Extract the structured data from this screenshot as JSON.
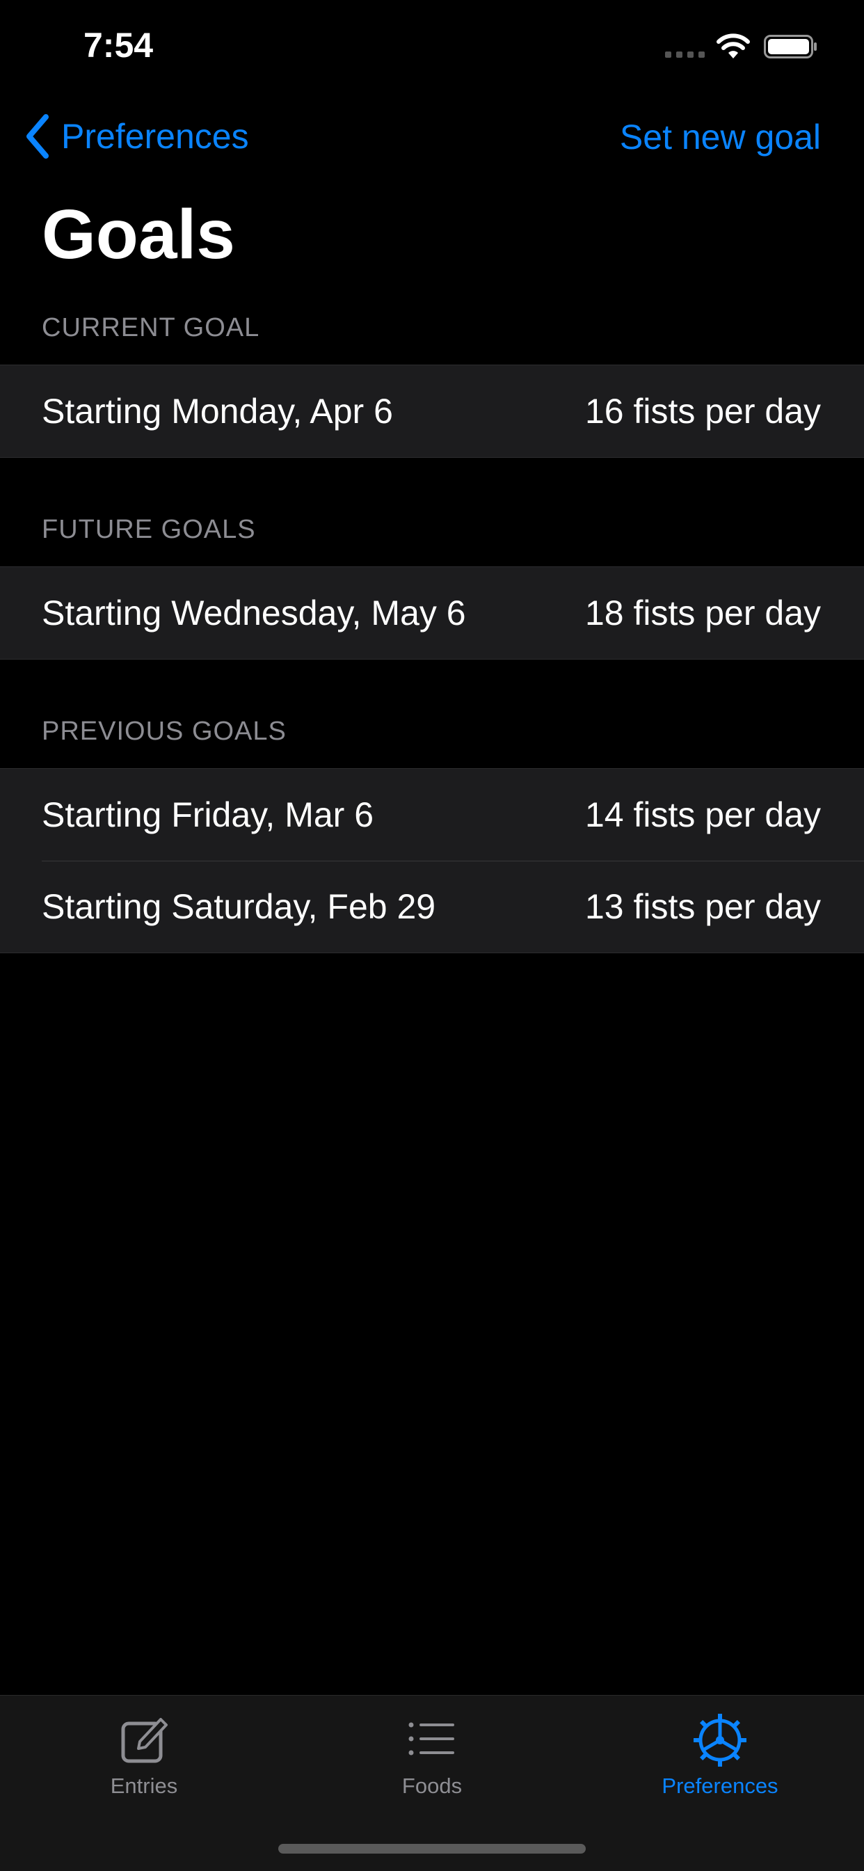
{
  "status_bar": {
    "time": "7:54"
  },
  "nav": {
    "back_label": "Preferences",
    "action_label": "Set new goal"
  },
  "page": {
    "title": "Goals"
  },
  "sections": {
    "current": {
      "header": "CURRENT GOAL",
      "rows": [
        {
          "label": "Starting Monday, Apr 6",
          "value": "16 fists per day"
        }
      ]
    },
    "future": {
      "header": "FUTURE GOALS",
      "rows": [
        {
          "label": "Starting Wednesday, May 6",
          "value": "18 fists per day"
        }
      ]
    },
    "previous": {
      "header": "PREVIOUS GOALS",
      "rows": [
        {
          "label": "Starting Friday, Mar 6",
          "value": "14 fists per day"
        },
        {
          "label": "Starting Saturday, Feb 29",
          "value": "13 fists per day"
        }
      ]
    }
  },
  "tab_bar": {
    "tabs": [
      {
        "label": "Entries",
        "icon": "compose-icon",
        "active": false
      },
      {
        "label": "Foods",
        "icon": "list-icon",
        "active": false
      },
      {
        "label": "Preferences",
        "icon": "gear-icon",
        "active": true
      }
    ]
  },
  "colors": {
    "accent": "#0a84ff",
    "background": "#000000",
    "cell": "#1c1c1e",
    "secondary_text": "#8d8d93",
    "inactive_tab": "#8e8e93"
  }
}
